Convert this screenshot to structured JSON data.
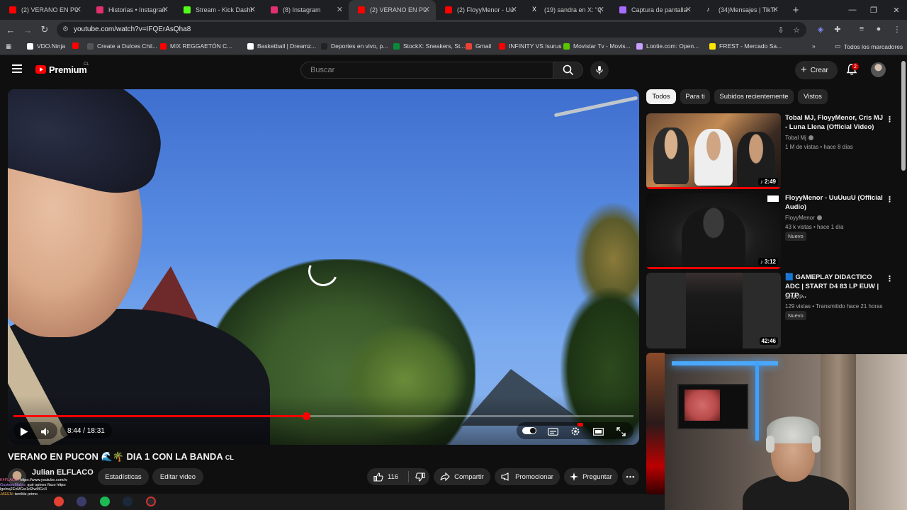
{
  "browser": {
    "tabs": [
      {
        "label": "(2) VERANO EN PUCÓ",
        "color": "#ff0000",
        "active": false
      },
      {
        "label": "Historias • Instagram",
        "color": "#e1306c",
        "active": false
      },
      {
        "label": "Stream - Kick Dashbo",
        "color": "#53fc18",
        "active": false
      },
      {
        "label": "(8) Instagram",
        "color": "#e1306c",
        "active": false
      },
      {
        "label": "(2) VERANO EN PUC",
        "color": "#ff0000",
        "active": true
      },
      {
        "label": "(2) FloyyMenor - UuU",
        "color": "#ff0000",
        "active": false
      },
      {
        "label": "(19) sandra en X: \"Qu",
        "color": "#ffffff",
        "active": false
      },
      {
        "label": "Captura de pantalla",
        "color": "#a66cff",
        "active": false
      },
      {
        "label": "(34)Mensajes | TikTok",
        "color": "#ffffff",
        "active": false
      }
    ],
    "url": "youtube.com/watch?v=IFQErAsQha8",
    "bookmarks": [
      {
        "label": "VDO.Ninja",
        "color": "#ffffff"
      },
      {
        "label": "",
        "color": "#ff0000"
      },
      {
        "label": "Create a Dulces Chil...",
        "color": "#555555"
      },
      {
        "label": "MIX REGGAETÓN C...",
        "color": "#ff0000"
      },
      {
        "label": "Basketball | Dreamz...",
        "color": "#ffffff"
      },
      {
        "label": "Deportes en vivo, p...",
        "color": "#222222"
      },
      {
        "label": "StockX: Sneakers, St...",
        "color": "#0b8a3a"
      },
      {
        "label": "Gmail",
        "color": "#ea4335"
      },
      {
        "label": "INFINITY VS Isurus",
        "color": "#ff0000"
      },
      {
        "label": "Movistar Tv - Movis...",
        "color": "#5bc500"
      },
      {
        "label": "Lootie.com: Open...",
        "color": "#c8a0ff"
      },
      {
        "label": "FREST - Mercado Sa...",
        "color": "#ffe600"
      },
      {
        "label": "Todos los marcadores",
        "color": "#cccccc"
      }
    ]
  },
  "youtube": {
    "logo_text": "Premium",
    "region": "CL",
    "search_placeholder": "Buscar",
    "create_label": "Crear",
    "notifications": "2"
  },
  "player": {
    "current_time": "8:44",
    "total_time": "18:31",
    "time_display": "8:44 / 18:31",
    "progress_fraction": 0.4717
  },
  "video": {
    "title": "VERANO EN PUCON 🌊🌴 DIA 1 CON LA BANDA",
    "title_suffix": "CL",
    "channel": "Julian ELFLACO",
    "stats_label": "Estadísticas",
    "edit_label": "Editar video",
    "likes": "116",
    "share_label": "Compartir",
    "promote_label": "Promocionar",
    "ask_label": "Preguntar"
  },
  "chat": [
    {
      "user": "K4FLACO",
      "text": ": https://www.youtube.com/w"
    },
    {
      "user": "GustavoMalpo",
      "text": ": qué opines flaco https:"
    },
    {
      "user": "",
      "text": "lgelnq2ExMGw1d2lwMGc3"
    },
    {
      "user": "JAEEN",
      "text": ": terrible primo"
    }
  ],
  "sidebar": {
    "chips": [
      "Todos",
      "Para ti",
      "Subidos recientemente",
      "Vistos"
    ],
    "videos": [
      {
        "title": "Tobal MJ, FloyyMenor, Cris MJ - Luna Llena (Official Video)",
        "channel": "Tobal Mj",
        "meta": "1 M de vistas • hace 8 días",
        "duration": "2:49",
        "badge": ""
      },
      {
        "title": "FloyyMenor - UuUuuU (Official Audio)",
        "channel": "FloyyMenor",
        "meta": "43 k vistas • hace 1 día",
        "duration": "3:12",
        "badge": "Nuevo"
      },
      {
        "title": "🟦 GAMEPLAY DIDACTICO ADC | START D4 83 LP EUW | OTP ...",
        "channel": "SrMVP",
        "meta": "129 vistas • Transmitido hace 21 horas",
        "duration": "42:46",
        "badge": "Nuevo"
      }
    ]
  }
}
